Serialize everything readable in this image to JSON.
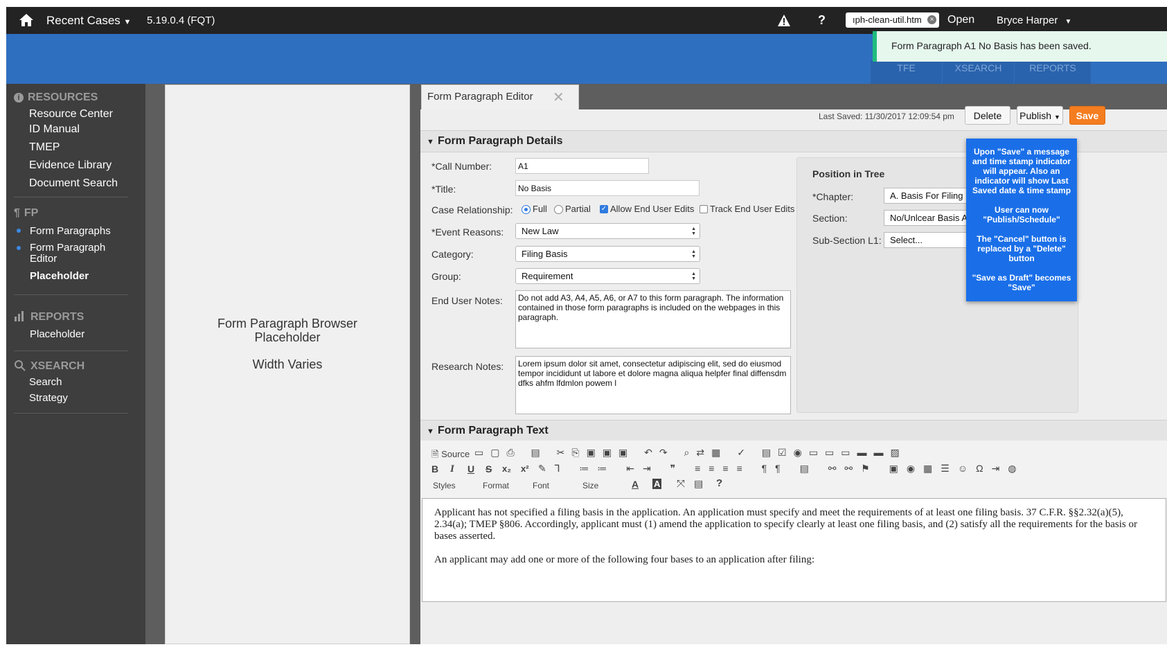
{
  "topbar": {
    "recent_cases": "Recent Cases",
    "version": "5.19.0.4 (FQT)",
    "file_input_value": "ıph-clean-util.htm",
    "open_label": "Open",
    "user_name": "Bryce Harper",
    "help_icon": "?"
  },
  "bluebar_tabs": [
    "TFE",
    "XSEARCH",
    "REPORTS"
  ],
  "toast": {
    "message": "Form Paragraph A1 No Basis has been saved."
  },
  "sidebar": {
    "resources": {
      "heading": "RESOURCES",
      "items": [
        "Resource Center",
        "ID Manual",
        "TMEP",
        "Evidence Library",
        "Document Search"
      ]
    },
    "fp": {
      "heading": "FP",
      "items": [
        "Form Paragraphs",
        "Form Paragraph Editor",
        "Placeholder"
      ]
    },
    "reports": {
      "heading": "REPORTS",
      "items": [
        "Placeholder"
      ]
    },
    "xsearch": {
      "heading": "XSEARCH",
      "items": [
        "Search",
        "Strategy"
      ]
    }
  },
  "browser": {
    "line1": "Form Paragraph Browser",
    "line2": "Placeholder",
    "line3": "Width Varies"
  },
  "editor": {
    "tab_title": "Form Paragraph Editor",
    "last_saved": "Last Saved: 11/30/2017 12:09:54 pm",
    "delete_label": "Delete",
    "publish_label": "Publish",
    "save_label": "Save",
    "details_heading": "Form Paragraph Details",
    "fields": {
      "call_number_label": "*Call Number:",
      "call_number_value": "A1",
      "title_label": "*Title:",
      "title_value": "No Basis",
      "case_relationship_label": "Case Relationship:",
      "full_label": "Full",
      "partial_label": "Partial",
      "allow_edits_label": "Allow End User Edits",
      "track_edits_label": "Track End User Edits",
      "event_reasons_label": "*Event Reasons:",
      "event_reasons_value": "New Law",
      "category_label": "Category:",
      "category_value": "Filing Basis",
      "group_label": "Group:",
      "group_value": "Requirement",
      "end_user_notes_label": "End User Notes:",
      "end_user_notes_value": "Do not add A3, A4, A5, A6, or A7 to this form paragraph.  The information contained in those form paragraphs is included on the webpages in this paragraph.",
      "research_notes_label": "Research Notes:",
      "research_notes_value": "Lorem ipsum dolor sit amet, consectetur adipiscing elit, sed do eiusmod tempor incididunt ut labore et dolore magna aliqua helpfer final diffensdm dfks ahfm lfdmlon powem l"
    },
    "tree": {
      "heading": "Position in Tree",
      "chapter_label": "*Chapter:",
      "chapter_value": "A. Basis For Filing",
      "section_label": "Section:",
      "section_value": "No/Unlcear Basis A1",
      "subsection_label": "Sub-Section L1:",
      "subsection_value": "Select..."
    },
    "text_heading": "Form Paragraph Text",
    "toolbar": {
      "source_label": "Source",
      "styles_label": "Styles",
      "format_label": "Format",
      "font_label": "Font",
      "size_label": "Size"
    },
    "content": {
      "para1": "Applicant has not specified a filing basis in the application. An application must specify and meet the requirements of at least one filing basis. 37 C.F.R. §§2.32(a)(5), 2.34(a); TMEP §806. Accordingly, applicant must (1) amend the application to specify clearly at least one filing basis, and (2) satisfy all the requirements for the basis or bases asserted.",
      "para2": "An applicant may add one or more of the following four bases to an application after filing:"
    }
  },
  "annotation": {
    "p1": "Upon \"Save\" a message and time stamp indicator will appear. Also an indicator will show Last Saved date & time stamp",
    "p2": "User can now \"Publish/Schedule\"",
    "p3": "The \"Cancel\" button is replaced by a \"Delete\" button",
    "p4": "\"Save as Draft\" becomes \"Save\""
  },
  "colors": {
    "accent_blue": "#2f6fc0",
    "save_orange": "#f47d20",
    "toast_green": "#1fbc7e",
    "note_blue": "#1a6fe8"
  }
}
